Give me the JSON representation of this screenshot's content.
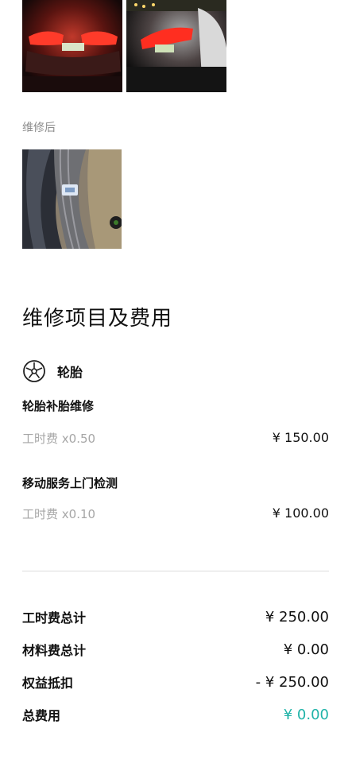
{
  "photos_before": [
    "car-rear-lights-photo",
    "car-rear-lights-photo"
  ],
  "after_label": "维修后",
  "photos_after": [
    "tire-repair-photo"
  ],
  "section_title": "维修项目及费用",
  "category": {
    "icon": "wheel-icon",
    "label": "轮胎"
  },
  "items": [
    {
      "name": "轮胎补胎维修",
      "fee_label": "工时费 x0.50",
      "price": "¥ 150.00"
    },
    {
      "name": "移动服务上门检测",
      "fee_label": "工时费 x0.10",
      "price": "¥ 100.00"
    }
  ],
  "summary": [
    {
      "label": "工时费总计",
      "value": "¥ 250.00"
    },
    {
      "label": "材料费总计",
      "value": "¥ 0.00"
    },
    {
      "label": "权益抵扣",
      "value": "- ¥ 250.00"
    },
    {
      "label": "总费用",
      "value": "¥ 0.00"
    }
  ],
  "colors": {
    "accent": "#1fb3a8",
    "muted": "#a6a6a6"
  }
}
